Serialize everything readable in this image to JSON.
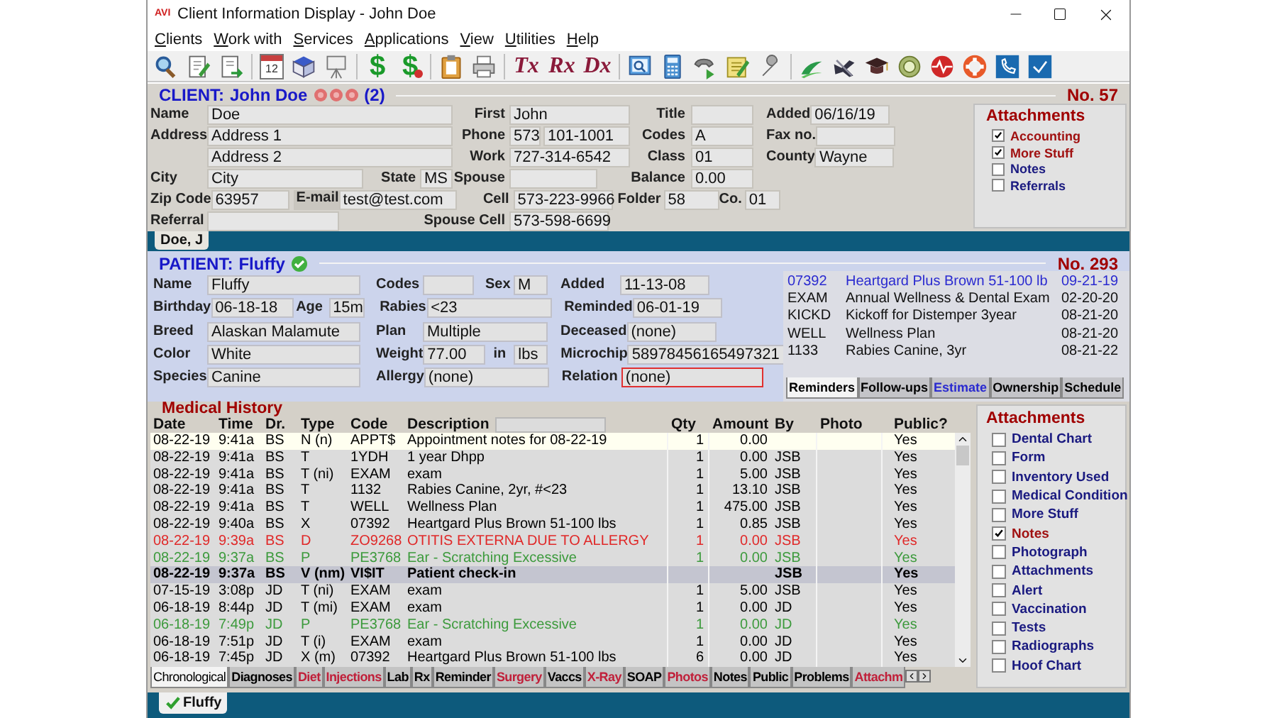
{
  "window": {
    "logo": "AVI",
    "title": "Client Information Display - John Doe"
  },
  "menu": [
    "Clients",
    "Work with",
    "Services",
    "Applications",
    "View",
    "Utilities",
    "Help"
  ],
  "toolbar": [
    {
      "kind": "icon"
    },
    {
      "kind": "icon"
    },
    {
      "kind": "icon"
    },
    {
      "kind": "separator"
    },
    {
      "kind": "calendar",
      "text": "12"
    },
    {
      "kind": "icon"
    },
    {
      "kind": "icon"
    },
    {
      "kind": "separator"
    },
    {
      "kind": "dollar",
      "text": "$"
    },
    {
      "kind": "dollar_badge",
      "text": "$"
    },
    {
      "kind": "separator"
    },
    {
      "kind": "icon"
    },
    {
      "kind": "icon"
    },
    {
      "kind": "separator"
    },
    {
      "kind": "script",
      "text": "Tx"
    },
    {
      "kind": "script",
      "text": "Rx"
    },
    {
      "kind": "script",
      "text": "Dx"
    },
    {
      "kind": "separator"
    },
    {
      "kind": "icon"
    },
    {
      "kind": "icon"
    },
    {
      "kind": "icon"
    },
    {
      "kind": "icon"
    },
    {
      "kind": "icon"
    },
    {
      "kind": "separator"
    },
    {
      "kind": "icon"
    },
    {
      "kind": "icon"
    },
    {
      "kind": "icon"
    },
    {
      "kind": "icon"
    },
    {
      "kind": "icon"
    },
    {
      "kind": "icon"
    },
    {
      "kind": "icon"
    },
    {
      "kind": "icon"
    }
  ],
  "client": {
    "heading": "CLIENT:",
    "name": "John Doe",
    "alerts": [
      {
        "kind": "flag"
      },
      {
        "kind": "flag"
      },
      {
        "kind": "flag"
      }
    ],
    "count": "(2)",
    "number": "No. 57",
    "last_name": {
      "label": "Name",
      "value": "Doe"
    },
    "address_1": {
      "label": "Address",
      "value": "Address 1"
    },
    "address_2": {
      "value": "Address 2"
    },
    "city": {
      "label": "City",
      "value": "City"
    },
    "state": {
      "label": "State",
      "value": "MS"
    },
    "zip_code": {
      "label": "Zip Code",
      "value": "63957"
    },
    "email": {
      "label": "E-mail",
      "value": "test@test.com"
    },
    "referral": {
      "label": "Referral"
    },
    "first_name": {
      "label": "First",
      "value": "John"
    },
    "phone": {
      "label": "Phone",
      "area": "573",
      "value": "101-1001"
    },
    "work": {
      "label": "Work",
      "value": "727-314-6542"
    },
    "spouse": {
      "label": "Spouse"
    },
    "cell": {
      "label": "Cell",
      "value": "573-223-9966"
    },
    "spouse_cell": {
      "label": "Spouse Cell",
      "value": "573-598-6699"
    },
    "title": {
      "label": "Title"
    },
    "codes": {
      "label": "Codes",
      "value": "A"
    },
    "class": {
      "label": "Class",
      "value": "01"
    },
    "balance": {
      "label": "Balance",
      "value": "0.00"
    },
    "folder": {
      "label": "Folder",
      "value": "58"
    },
    "co": {
      "label": "Co.",
      "value": "01"
    },
    "added": {
      "label": "Added",
      "value": "06/16/19"
    },
    "fax": {
      "label": "Fax no."
    },
    "county": {
      "label": "County",
      "value": "Wayne"
    },
    "attachments": {
      "title": "Attachments",
      "items": [
        {
          "label": "Accounting",
          "checked": true
        },
        {
          "label": "More Stuff",
          "checked": true
        },
        {
          "label": "Notes",
          "checked": false
        },
        {
          "label": "Referrals",
          "checked": false
        }
      ]
    },
    "tabs": [
      {
        "label": "Doe, J",
        "selected": true
      }
    ]
  },
  "patient": {
    "heading": "PATIENT:",
    "name": "Fluffy",
    "verified": true,
    "number": "No. 293",
    "name_field": {
      "label": "Name",
      "value": "Fluffy"
    },
    "birthday": {
      "label": "Birthday",
      "value": "06-18-18"
    },
    "age": {
      "label": "Age",
      "value": "15m"
    },
    "breed": {
      "label": "Breed",
      "value": "Alaskan Malamute"
    },
    "color": {
      "label": "Color",
      "value": "White"
    },
    "species": {
      "label": "Species",
      "value": "Canine"
    },
    "codes": {
      "label": "Codes"
    },
    "sex": {
      "label": "Sex",
      "value": "M"
    },
    "rabies": {
      "label": "Rabies",
      "value": "<23"
    },
    "plan": {
      "label": "Plan",
      "value": "Multiple"
    },
    "weight": {
      "label": "Weight",
      "value": "77.00"
    },
    "unit": {
      "label": "in",
      "value": "lbs"
    },
    "allergy": {
      "label": "Allergy",
      "value": "(none)"
    },
    "added": {
      "label": "Added",
      "value": "11-13-08"
    },
    "reminded": {
      "label": "Reminded",
      "value": "06-01-19"
    },
    "deceased": {
      "label": "Deceased",
      "value": "(none)"
    },
    "microchip": {
      "label": "Microchip",
      "value": "58978456165497321"
    },
    "relation": {
      "label": "Relation",
      "value": "(none)",
      "focused": true
    },
    "reminders": [
      {
        "code": "07392",
        "description": "Heartgard Plus Brown 51-100 lb",
        "date": "09-21-19",
        "selected": true
      },
      {
        "code": "EXAM",
        "description": "Annual Wellness & Dental Exam",
        "date": "02-20-20",
        "selected": false
      },
      {
        "code": "KICKD",
        "description": "Kickoff for Distemper 3year",
        "date": "08-21-20",
        "selected": false
      },
      {
        "code": "WELL",
        "description": "Wellness Plan",
        "date": "08-21-20",
        "selected": false
      },
      {
        "code": "1133",
        "description": "Rabies Canine, 3yr",
        "date": "08-21-22",
        "selected": false
      }
    ],
    "tabs": [
      {
        "label": "Reminders",
        "selected": true,
        "color": "#000000"
      },
      {
        "label": "Follow-ups",
        "selected": false,
        "color": "#000000"
      },
      {
        "label": "Estimate",
        "selected": false,
        "color": "#2a2ad0"
      },
      {
        "label": "Ownership",
        "selected": false,
        "color": "#000000"
      },
      {
        "label": "Schedule",
        "selected": false,
        "color": "#000000"
      }
    ]
  },
  "medical_history": {
    "title": "Medical History",
    "columns": [
      "Date",
      "Time",
      "Dr.",
      "Type",
      "Code",
      "Description",
      "Qty",
      "Amount",
      "By",
      "Photo",
      "Public?"
    ],
    "rows": [
      {
        "date": "08-22-19",
        "time": "9:41a",
        "dr": "BS",
        "type": "N (n)",
        "code": "APPT$",
        "description": "Appointment notes for 08-22-19",
        "qty": "1",
        "amount": "0.00",
        "public": "Yes",
        "color": "#000000",
        "selected": false,
        "focused": true
      },
      {
        "date": "08-22-19",
        "time": "9:41a",
        "dr": "BS",
        "type": "T",
        "code": "1YDH",
        "description": "1 year Dhpp",
        "qty": "1",
        "amount": "0.00",
        "by": "JSB",
        "public": "Yes",
        "color": "#000000",
        "selected": false,
        "focused": false
      },
      {
        "date": "08-22-19",
        "time": "9:41a",
        "dr": "BS",
        "type": "T (ni)",
        "code": "EXAM",
        "description": "exam",
        "qty": "1",
        "amount": "5.00",
        "by": "JSB",
        "public": "Yes",
        "color": "#000000",
        "selected": false,
        "focused": false
      },
      {
        "date": "08-22-19",
        "time": "9:41a",
        "dr": "BS",
        "type": "T",
        "code": "1132",
        "description": "Rabies Canine, 2yr, #<23",
        "qty": "1",
        "amount": "13.10",
        "by": "JSB",
        "public": "Yes",
        "color": "#000000",
        "selected": false,
        "focused": false
      },
      {
        "date": "08-22-19",
        "time": "9:41a",
        "dr": "BS",
        "type": "T",
        "code": "WELL",
        "description": "Wellness Plan",
        "qty": "1",
        "amount": "475.00",
        "by": "JSB",
        "public": "Yes",
        "color": "#000000",
        "selected": false,
        "focused": false
      },
      {
        "date": "08-22-19",
        "time": "9:40a",
        "dr": "BS",
        "type": "X",
        "code": "07392",
        "description": "Heartgard Plus Brown 51-100 lbs",
        "qty": "1",
        "amount": "0.85",
        "by": "JSB",
        "public": "Yes",
        "color": "#000000",
        "selected": false,
        "focused": false
      },
      {
        "date": "08-22-19",
        "time": "9:39a",
        "dr": "BS",
        "type": "D",
        "code": "ZO9268",
        "description": "OTITIS EXTERNA DUE TO ALLERGY",
        "qty": "1",
        "amount": "0.00",
        "by": "JSB",
        "public": "Yes",
        "color": "#e02828",
        "selected": false,
        "focused": false
      },
      {
        "date": "08-22-19",
        "time": "9:37a",
        "dr": "BS",
        "type": "P",
        "code": "PE3768",
        "description": "Ear - Scratching Excessive",
        "qty": "1",
        "amount": "0.00",
        "by": "JSB",
        "public": "Yes",
        "color": "#3c9a3c",
        "selected": false,
        "focused": false
      },
      {
        "date": "08-22-19",
        "time": "9:37a",
        "dr": "BS",
        "type": "V (nm)",
        "code": "VI$IT",
        "description": "Patient check-in",
        "by": "JSB",
        "public": "Yes",
        "color": "#000000",
        "selected": true,
        "focused": false
      },
      {
        "date": "07-15-19",
        "time": "3:08p",
        "dr": "JD",
        "type": "T (ni)",
        "code": "EXAM",
        "description": "exam",
        "qty": "1",
        "amount": "5.00",
        "by": "JSB",
        "public": "Yes",
        "color": "#000000",
        "selected": false,
        "focused": false
      },
      {
        "date": "06-18-19",
        "time": "8:44p",
        "dr": "JD",
        "type": "T (mi)",
        "code": "EXAM",
        "description": "exam",
        "qty": "1",
        "amount": "0.00",
        "by": "JD",
        "public": "Yes",
        "color": "#000000",
        "selected": false,
        "focused": false
      },
      {
        "date": "06-18-19",
        "time": "7:49p",
        "dr": "JD",
        "type": "P",
        "code": "PE3768",
        "description": "Ear - Scratching Excessive",
        "qty": "1",
        "amount": "0.00",
        "by": "JD",
        "public": "Yes",
        "color": "#3c9a3c",
        "selected": false,
        "focused": false
      },
      {
        "date": "06-18-19",
        "time": "7:51p",
        "dr": "JD",
        "type": "T (i)",
        "code": "EXAM",
        "description": "exam",
        "qty": "1",
        "amount": "0.00",
        "by": "JD",
        "public": "Yes",
        "color": "#000000",
        "selected": false,
        "focused": false
      },
      {
        "date": "06-18-19",
        "time": "7:45p",
        "dr": "JD",
        "type": "X (m)",
        "code": "07392",
        "description": "Heartgard Plus Brown 51-100 lbs",
        "qty": "6",
        "amount": "0.00",
        "by": "JD",
        "public": "Yes",
        "color": "#000000",
        "selected": false,
        "focused": false
      }
    ],
    "tabs": [
      {
        "label": "Chronological",
        "selected": true,
        "color": "#000000"
      },
      {
        "label": "Diagnoses",
        "selected": false,
        "color": "#000000"
      },
      {
        "label": "Diet",
        "selected": false,
        "color": "#c0203a"
      },
      {
        "label": "Injections",
        "selected": false,
        "color": "#c0203a"
      },
      {
        "label": "Lab",
        "selected": false,
        "color": "#000000"
      },
      {
        "label": "Rx",
        "selected": false,
        "color": "#000000"
      },
      {
        "label": "Reminder",
        "selected": false,
        "color": "#000000"
      },
      {
        "label": "Surgery",
        "selected": false,
        "color": "#c0203a"
      },
      {
        "label": "Vaccs",
        "selected": false,
        "color": "#000000"
      },
      {
        "label": "X-Ray",
        "selected": false,
        "color": "#c0203a"
      },
      {
        "label": "SOAP",
        "selected": false,
        "color": "#000000"
      },
      {
        "label": "Photos",
        "selected": false,
        "color": "#c0203a"
      },
      {
        "label": "Notes",
        "selected": false,
        "color": "#000000"
      },
      {
        "label": "Public",
        "selected": false,
        "color": "#000000"
      },
      {
        "label": "Problems",
        "selected": false,
        "color": "#000000"
      },
      {
        "label": "Attachm",
        "selected": false,
        "color": "#c0203a"
      }
    ],
    "attachments": {
      "title": "Attachments",
      "items": [
        {
          "label": "Dental Chart",
          "checked": false
        },
        {
          "label": "Form",
          "checked": false
        },
        {
          "label": "Inventory Used",
          "checked": false
        },
        {
          "label": "Medical Condition",
          "checked": false
        },
        {
          "label": "More Stuff",
          "checked": false
        },
        {
          "label": "Notes",
          "checked": true
        },
        {
          "label": "Photograph",
          "checked": false
        },
        {
          "label": "Attachments",
          "checked": false
        },
        {
          "label": "Alert",
          "checked": false
        },
        {
          "label": "Vaccination",
          "checked": false
        },
        {
          "label": "Tests",
          "checked": false
        },
        {
          "label": "Radiographs",
          "checked": false
        },
        {
          "label": "Hoof Chart",
          "checked": false
        }
      ]
    }
  },
  "patient_tabs": [
    {
      "label": "Fluffy",
      "selected": true,
      "verified": true
    }
  ]
}
